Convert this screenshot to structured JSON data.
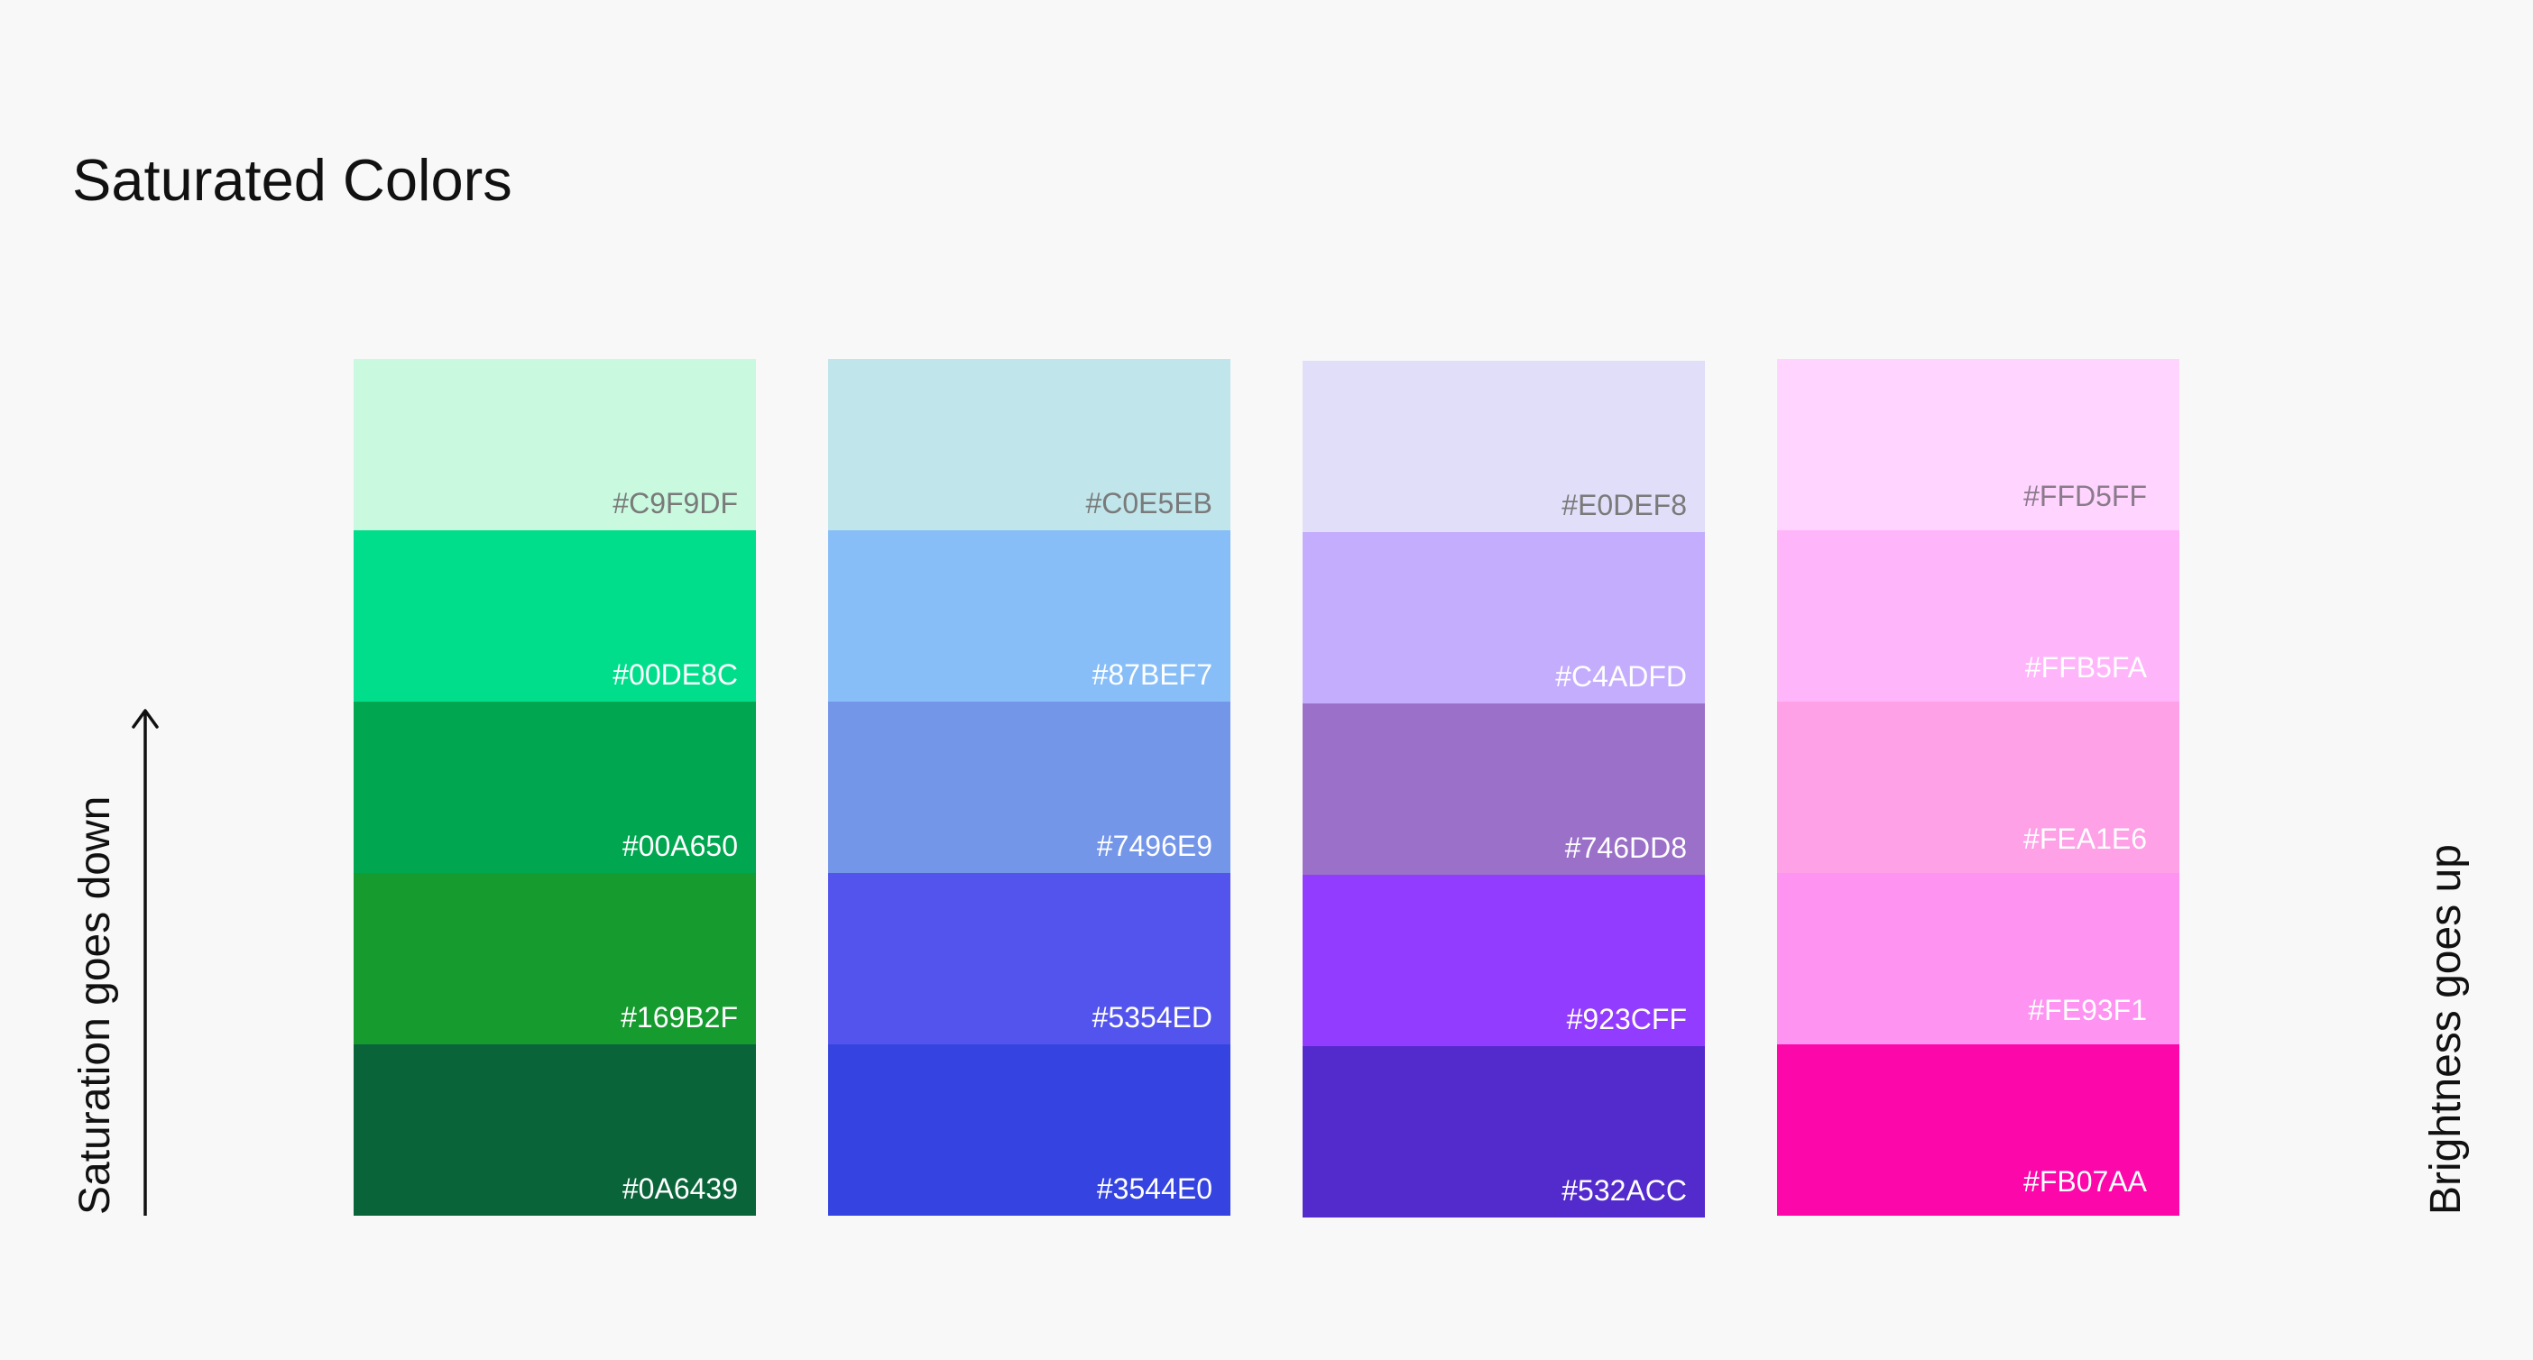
{
  "title": "Saturated Colors",
  "left_axis_label": "Saturation goes down",
  "right_axis_label": "Brightness goes up",
  "palettes": [
    {
      "name": "green",
      "swatches": [
        {
          "hex": "#C9F9DF",
          "label_color": "#7a7a7a"
        },
        {
          "hex": "#00DE8C",
          "label_color": "#ffffff"
        },
        {
          "hex": "#00A650",
          "label_color": "#ffffff"
        },
        {
          "hex": "#169B2F",
          "label_color": "#ffffff"
        },
        {
          "hex": "#0A6439",
          "label_color": "#ffffff"
        }
      ]
    },
    {
      "name": "blue",
      "swatches": [
        {
          "hex": "#C0E5EB",
          "label_color": "#7a7a7a"
        },
        {
          "hex": "#87BEF7",
          "label_color": "#ffffff"
        },
        {
          "hex": "#7496E9",
          "label_color": "#ffffff"
        },
        {
          "hex": "#5354ED",
          "label_color": "#ffffff"
        },
        {
          "hex": "#3544E0",
          "label_color": "#ffffff"
        }
      ]
    },
    {
      "name": "purple",
      "swatches": [
        {
          "hex": "#E0DEF8",
          "label_color": "#7a7a7a"
        },
        {
          "hex": "#C4ADFD",
          "label_color": "#ffffff"
        },
        {
          "hex": "#746DD8",
          "label_color": "#ffffff"
        },
        {
          "hex": "#923CFF",
          "label_color": "#ffffff"
        },
        {
          "hex": "#532ACC",
          "label_color": "#ffffff"
        }
      ]
    },
    {
      "name": "pink",
      "swatches": [
        {
          "hex": "#FFD5FF",
          "label_color": "#8a7a8a"
        },
        {
          "hex": "#FFB5FA",
          "label_color": "#ffffff"
        },
        {
          "hex": "#FEA1E6",
          "label_color": "#ffffff"
        },
        {
          "hex": "#FE93F1",
          "label_color": "#ffffff"
        },
        {
          "hex": "#FB07AA",
          "label_color": "#ffffff"
        }
      ]
    }
  ],
  "display_colors": {
    "green": [
      "#C9F9DF",
      "#00DE8C",
      "#00A650",
      "#169B2F",
      "#0A6439"
    ],
    "blue": [
      "#C0E5EB",
      "#87BEF7",
      "#7496E9",
      "#5354ED",
      "#3544E0"
    ],
    "purple": [
      "#E0DEF8",
      "#C4ADFD",
      "#9A70C8",
      "#923CFF",
      "#532ACC"
    ],
    "pink": [
      "#FFD5FF",
      "#FFB5FA",
      "#FEA1E6",
      "#FE93F1",
      "#FB07AA"
    ]
  }
}
